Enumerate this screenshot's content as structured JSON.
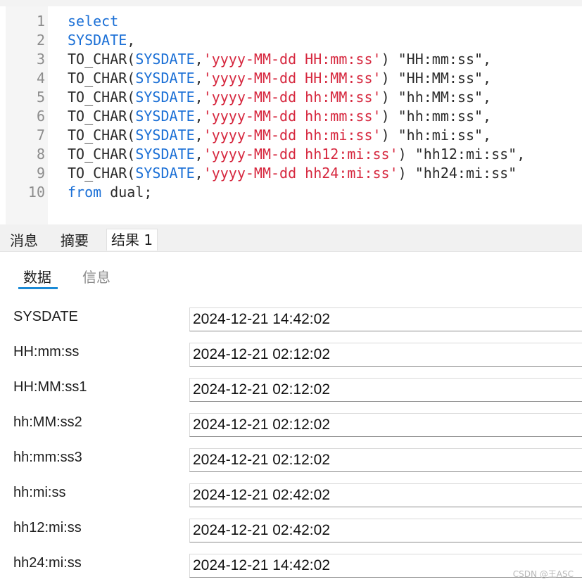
{
  "editor": {
    "lines": [
      {
        "no": "1",
        "tokens": [
          {
            "t": "kw",
            "v": "select"
          }
        ]
      },
      {
        "no": "2",
        "tokens": [
          {
            "t": "kw",
            "v": "SYSDATE"
          },
          {
            "t": "p",
            "v": ","
          }
        ]
      },
      {
        "no": "3",
        "tokens": [
          {
            "t": "fn",
            "v": "TO_CHAR"
          },
          {
            "t": "p",
            "v": "("
          },
          {
            "t": "sys",
            "v": "SYSDATE"
          },
          {
            "t": "p",
            "v": ","
          },
          {
            "t": "str",
            "v": "'yyyy-MM-dd HH:mm:ss'"
          },
          {
            "t": "p",
            "v": ") \"HH:mm:ss\","
          }
        ]
      },
      {
        "no": "4",
        "tokens": [
          {
            "t": "fn",
            "v": "TO_CHAR"
          },
          {
            "t": "p",
            "v": "("
          },
          {
            "t": "sys",
            "v": "SYSDATE"
          },
          {
            "t": "p",
            "v": ","
          },
          {
            "t": "str",
            "v": "'yyyy-MM-dd HH:MM:ss'"
          },
          {
            "t": "p",
            "v": ") \"HH:MM:ss\","
          }
        ]
      },
      {
        "no": "5",
        "tokens": [
          {
            "t": "fn",
            "v": "TO_CHAR"
          },
          {
            "t": "p",
            "v": "("
          },
          {
            "t": "sys",
            "v": "SYSDATE"
          },
          {
            "t": "p",
            "v": ","
          },
          {
            "t": "str",
            "v": "'yyyy-MM-dd hh:MM:ss'"
          },
          {
            "t": "p",
            "v": ") \"hh:MM:ss\","
          }
        ]
      },
      {
        "no": "6",
        "tokens": [
          {
            "t": "fn",
            "v": "TO_CHAR"
          },
          {
            "t": "p",
            "v": "("
          },
          {
            "t": "sys",
            "v": "SYSDATE"
          },
          {
            "t": "p",
            "v": ","
          },
          {
            "t": "str",
            "v": "'yyyy-MM-dd hh:mm:ss'"
          },
          {
            "t": "p",
            "v": ") \"hh:mm:ss\","
          }
        ]
      },
      {
        "no": "7",
        "tokens": [
          {
            "t": "fn",
            "v": "TO_CHAR"
          },
          {
            "t": "p",
            "v": "("
          },
          {
            "t": "sys",
            "v": "SYSDATE"
          },
          {
            "t": "p",
            "v": ","
          },
          {
            "t": "str",
            "v": "'yyyy-MM-dd hh:mi:ss'"
          },
          {
            "t": "p",
            "v": ") \"hh:mi:ss\","
          }
        ]
      },
      {
        "no": "8",
        "tokens": [
          {
            "t": "fn",
            "v": "TO_CHAR"
          },
          {
            "t": "p",
            "v": "("
          },
          {
            "t": "sys",
            "v": "SYSDATE"
          },
          {
            "t": "p",
            "v": ","
          },
          {
            "t": "str",
            "v": "'yyyy-MM-dd hh12:mi:ss'"
          },
          {
            "t": "p",
            "v": ") \"hh12:mi:ss\","
          }
        ]
      },
      {
        "no": "9",
        "tokens": [
          {
            "t": "fn",
            "v": "TO_CHAR"
          },
          {
            "t": "p",
            "v": "("
          },
          {
            "t": "sys",
            "v": "SYSDATE"
          },
          {
            "t": "p",
            "v": ","
          },
          {
            "t": "str",
            "v": "'yyyy-MM-dd hh24:mi:ss'"
          },
          {
            "t": "p",
            "v": ") \"hh24:mi:ss\""
          }
        ]
      },
      {
        "no": "10",
        "tokens": [
          {
            "t": "kw",
            "v": "from"
          },
          {
            "t": "p",
            "v": " dual;"
          }
        ]
      }
    ]
  },
  "result_tabs": [
    {
      "label": "消息"
    },
    {
      "label": "摘要"
    },
    {
      "label": "结果 1"
    }
  ],
  "sub_tabs": {
    "data": "数据",
    "info": "信息"
  },
  "form_rows": [
    {
      "label": "SYSDATE",
      "value": "2024-12-21 14:42:02"
    },
    {
      "label": "HH:mm:ss",
      "value": "2024-12-21 02:12:02"
    },
    {
      "label": "HH:MM:ss1",
      "value": "2024-12-21 02:12:02"
    },
    {
      "label": "hh:MM:ss2",
      "value": "2024-12-21 02:12:02"
    },
    {
      "label": "hh:mm:ss3",
      "value": "2024-12-21 02:12:02"
    },
    {
      "label": "hh:mi:ss",
      "value": "2024-12-21 02:42:02"
    },
    {
      "label": "hh12:mi:ss",
      "value": "2024-12-21 02:42:02"
    },
    {
      "label": "hh24:mi:ss",
      "value": "2024-12-21 14:42:02"
    }
  ],
  "watermark": "CSDN @王ASC"
}
